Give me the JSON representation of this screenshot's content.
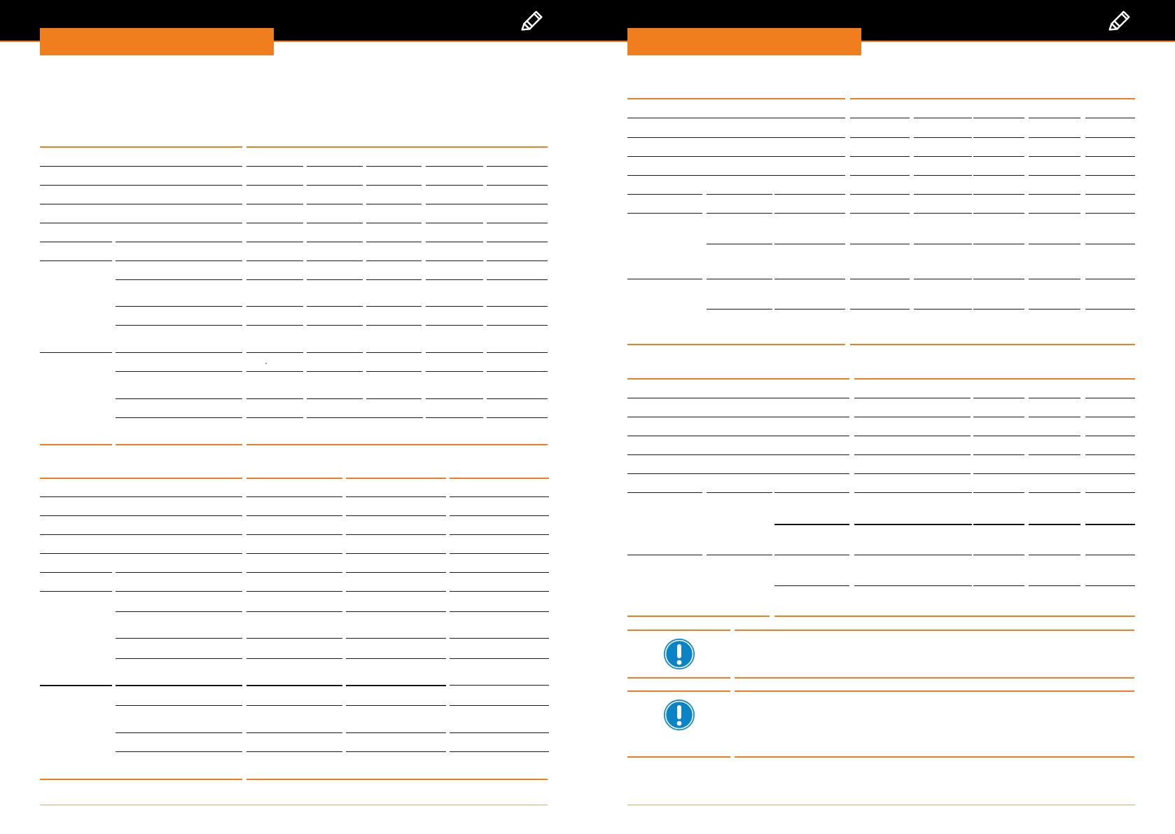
{
  "colors": {
    "accent": "#f07d1e",
    "header_background": "#000000",
    "notice_icon": "#0a84c6",
    "rule_dark": "#1a1a1a",
    "footer_rule": "#e0aa6f"
  },
  "icons": {
    "header": "pencil-edit-icon",
    "notice": "exclamation-circle-icon"
  },
  "left_page": {
    "title": "",
    "tables": [
      {
        "name": "upper-spec-table",
        "columns": 6,
        "text": []
      },
      {
        "name": "lower-spec-table",
        "columns": 4,
        "text": []
      }
    ]
  },
  "right_page": {
    "title": "",
    "tables": [
      {
        "name": "upper-spec-table",
        "columns": 8,
        "text": []
      },
      {
        "name": "lower-spec-table",
        "columns": 8,
        "text": []
      }
    ],
    "notices": [
      {
        "icon": "exclamation-circle-icon",
        "text": ""
      },
      {
        "icon": "exclamation-circle-icon",
        "text": ""
      }
    ]
  }
}
